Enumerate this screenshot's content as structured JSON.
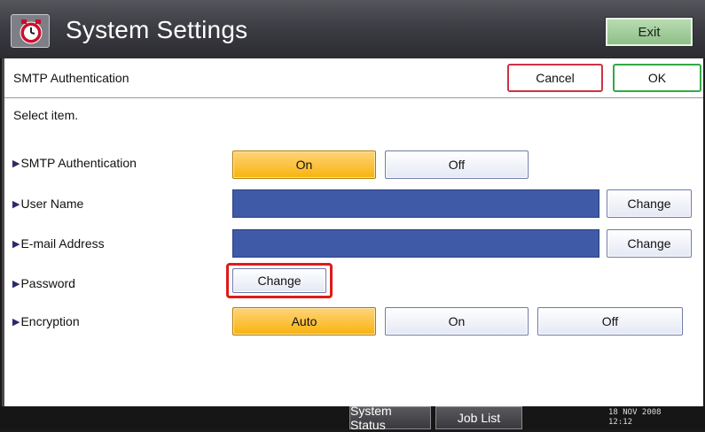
{
  "window": {
    "title": "System Settings",
    "app_icon": "system-settings-icon",
    "exit_label": "Exit"
  },
  "header": {
    "title": "SMTP Authentication",
    "cancel_label": "Cancel",
    "ok_label": "OK"
  },
  "prompt": "Select item.",
  "settings": {
    "smtp_auth": {
      "label": "SMTP Authentication",
      "options": [
        "On",
        "Off"
      ],
      "selected": "On"
    },
    "user_name": {
      "label": "User Name",
      "value": "",
      "change_label": "Change"
    },
    "email": {
      "label": "E-mail Address",
      "value": "",
      "change_label": "Change"
    },
    "password": {
      "label": "Password",
      "change_label": "Change"
    },
    "encryption": {
      "label": "Encryption",
      "options": [
        "Auto",
        "On",
        "Off"
      ],
      "selected": "Auto"
    }
  },
  "statusbar": {
    "system_status_label": "System Status",
    "job_list_label": "Job List",
    "date": "18 NOV  2008",
    "time": "12:12"
  },
  "colors": {
    "selected": "#f7b30c",
    "field": "#3f5ba8",
    "highlight": "#e01a1a",
    "cancel_border": "#cc3344",
    "ok_border": "#33aa44",
    "exit_bg": "#8fc087"
  }
}
